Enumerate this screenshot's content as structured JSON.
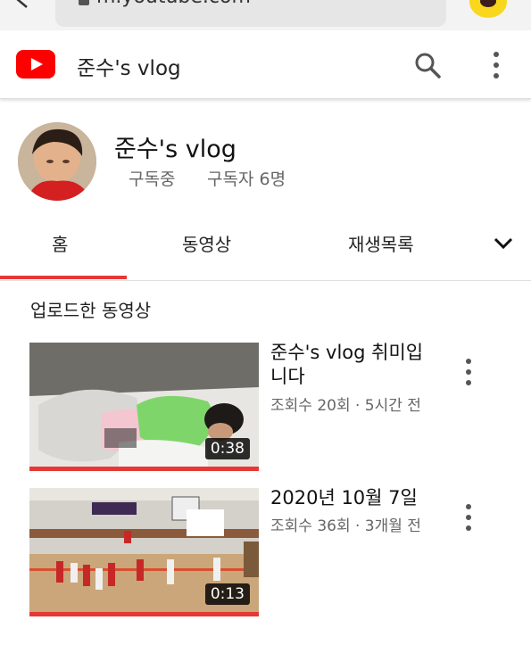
{
  "browser": {
    "url": "m.youtube.com"
  },
  "header": {
    "title": "준수's vlog"
  },
  "channel": {
    "name": "준수's vlog",
    "subscribe_status": "구독중",
    "subscriber_count": "구독자 6명"
  },
  "tabs": [
    {
      "label": "홈"
    },
    {
      "label": "동영상"
    },
    {
      "label": "재생목록"
    }
  ],
  "section": {
    "title": "업로드한 동영상"
  },
  "videos": [
    {
      "title": "준수's vlog 취미입니다",
      "meta": "조회수 20회 · 5시간 전",
      "duration": "0:38"
    },
    {
      "title": "2020년 10월 7일",
      "meta": "조회수 36회 · 3개월 전",
      "duration": "0:13"
    }
  ],
  "colors": {
    "accent": "#e53935",
    "youtube_red": "#ff0000",
    "kakao_yellow": "#f9d71c"
  }
}
